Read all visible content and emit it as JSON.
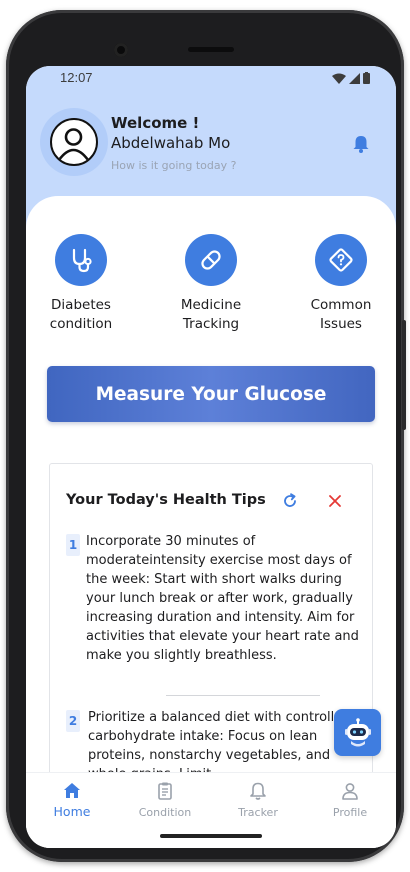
{
  "status_bar": {
    "time": "12:07",
    "icons": [
      "wifi-icon",
      "signal-icon",
      "battery-icon"
    ]
  },
  "header": {
    "welcome": "Welcome !",
    "user_name": "Abdelwahab Mo",
    "subtitle": "How is it going today ?",
    "avatar_icon": "user-avatar-icon",
    "notification_icon": "bell-icon"
  },
  "quick_actions": [
    {
      "label": "Diabetes\ncondition",
      "icon": "stethoscope-icon"
    },
    {
      "label": "Medicine\nTracking",
      "icon": "pill-icon"
    },
    {
      "label": "Common\nIssues",
      "icon": "question-diamond-icon"
    }
  ],
  "measure_button": {
    "label": "Measure Your Glucose"
  },
  "health_tips": {
    "title": "Your Today's Health Tips",
    "refresh_icon": "refresh-icon",
    "close_icon": "close-icon",
    "tips": [
      {
        "number": "1",
        "text": "Incorporate 30 minutes of moderateintensity exercise most days of the week:  Start with short walks during your lunch break or after work, gradually increasing duration and intensity.  Aim for activities that elevate your heart rate and make you slightly breathless."
      },
      {
        "number": "2",
        "text": "Prioritize a balanced diet with controlled carbohydrate intake: Focus on lean proteins, nonstarchy vegetables, and whole grains. Limit"
      }
    ]
  },
  "chatbot_fab": {
    "icon": "robot-icon"
  },
  "bottom_nav": {
    "items": [
      {
        "label": "Home",
        "icon": "home-icon",
        "active": true
      },
      {
        "label": "Condition",
        "icon": "clipboard-icon",
        "active": false
      },
      {
        "label": "Tracker",
        "icon": "bell-icon",
        "active": false
      },
      {
        "label": "Profile",
        "icon": "person-icon",
        "active": false
      }
    ]
  },
  "colors": {
    "primary": "#3f7de0",
    "header_bg": "#c5dafc",
    "button_gradient_start": "#4066c0",
    "close_red": "#e53935"
  }
}
